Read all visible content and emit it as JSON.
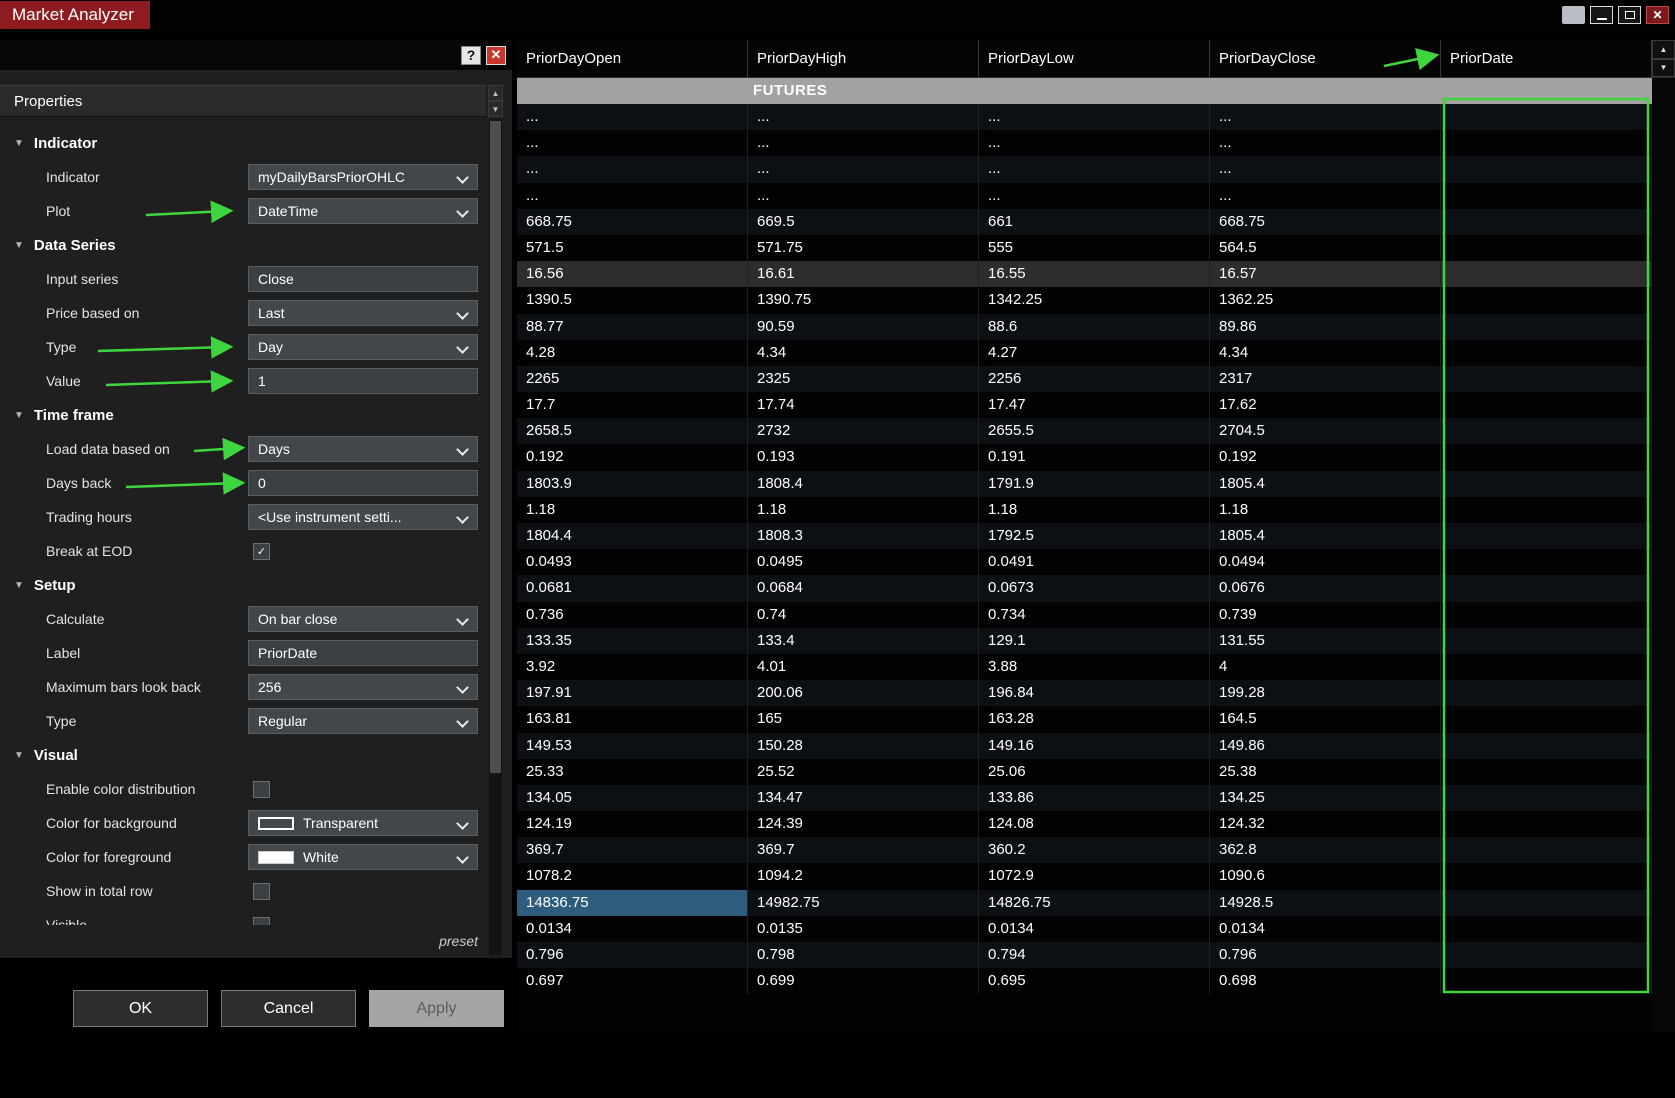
{
  "window": {
    "title": "Market Analyzer"
  },
  "icons": {
    "help": "?",
    "close": "✕",
    "check": "✓",
    "collapse_arrow": "▼",
    "scroll_up": "▲",
    "scroll_down": "▼"
  },
  "dialog": {
    "header": "Properties",
    "sections": [
      {
        "label": "Indicator",
        "rows": [
          {
            "label": "Indicator",
            "type": "dropdown",
            "value": "myDailyBarsPriorOHLC"
          },
          {
            "label": "Plot",
            "type": "dropdown",
            "value": "DateTime"
          }
        ]
      },
      {
        "label": "Data Series",
        "rows": [
          {
            "label": "Input series",
            "type": "text",
            "value": "Close"
          },
          {
            "label": "Price based on",
            "type": "dropdown",
            "value": "Last"
          },
          {
            "label": "Type",
            "type": "dropdown",
            "value": "Day"
          },
          {
            "label": "Value",
            "type": "text",
            "value": "1"
          }
        ]
      },
      {
        "label": "Time frame",
        "rows": [
          {
            "label": "Load data based on",
            "type": "dropdown",
            "value": "Days"
          },
          {
            "label": "Days back",
            "type": "text",
            "value": "0"
          },
          {
            "label": "Trading hours",
            "type": "dropdown",
            "value": "<Use instrument setti..."
          },
          {
            "label": "Break at EOD",
            "type": "checkbox",
            "checked": true
          }
        ]
      },
      {
        "label": "Setup",
        "rows": [
          {
            "label": "Calculate",
            "type": "dropdown",
            "value": "On bar close"
          },
          {
            "label": "Label",
            "type": "text",
            "value": "PriorDate"
          },
          {
            "label": "Maximum bars look back",
            "type": "dropdown",
            "value": "256"
          },
          {
            "label": "Type",
            "type": "dropdown",
            "value": "Regular"
          }
        ]
      },
      {
        "label": "Visual",
        "rows": [
          {
            "label": "Enable color distribution",
            "type": "checkbox",
            "checked": false
          },
          {
            "label": "Color for background",
            "type": "color",
            "value": "Transparent",
            "swatch": "transparent"
          },
          {
            "label": "Color for foreground",
            "type": "color",
            "value": "White",
            "swatch": "white"
          },
          {
            "label": "Show in total row",
            "type": "checkbox",
            "checked": false
          },
          {
            "label": "Visible",
            "type": "checkbox",
            "checked": false,
            "clipped": true
          }
        ]
      }
    ],
    "preset_label": "preset",
    "buttons": [
      {
        "label": "OK"
      },
      {
        "label": "Cancel"
      },
      {
        "label": "Apply",
        "disabled": true
      }
    ]
  },
  "table": {
    "columns": [
      "PriorDayOpen",
      "PriorDayHigh",
      "PriorDayLow",
      "PriorDayClose",
      "PriorDate"
    ],
    "group_label": "FUTURES",
    "highlighted_row_index": 6,
    "selected_cell": {
      "row": 30,
      "col": 0
    },
    "rows": [
      [
        "...",
        "...",
        "...",
        "..."
      ],
      [
        "...",
        "...",
        "...",
        "..."
      ],
      [
        "...",
        "...",
        "...",
        "..."
      ],
      [
        "...",
        "...",
        "...",
        "..."
      ],
      [
        "668.75",
        "669.5",
        "661",
        "668.75"
      ],
      [
        "571.5",
        "571.75",
        "555",
        "564.5"
      ],
      [
        "16.56",
        "16.61",
        "16.55",
        "16.57"
      ],
      [
        "1390.5",
        "1390.75",
        "1342.25",
        "1362.25"
      ],
      [
        "88.77",
        "90.59",
        "88.6",
        "89.86"
      ],
      [
        "4.28",
        "4.34",
        "4.27",
        "4.34"
      ],
      [
        "2265",
        "2325",
        "2256",
        "2317"
      ],
      [
        "17.7",
        "17.74",
        "17.47",
        "17.62"
      ],
      [
        "2658.5",
        "2732",
        "2655.5",
        "2704.5"
      ],
      [
        "0.192",
        "0.193",
        "0.191",
        "0.192"
      ],
      [
        "1803.9",
        "1808.4",
        "1791.9",
        "1805.4"
      ],
      [
        "1.18",
        "1.18",
        "1.18",
        "1.18"
      ],
      [
        "1804.4",
        "1808.3",
        "1792.5",
        "1805.4"
      ],
      [
        "0.0493",
        "0.0495",
        "0.0491",
        "0.0494"
      ],
      [
        "0.0681",
        "0.0684",
        "0.0673",
        "0.0676"
      ],
      [
        "0.736",
        "0.74",
        "0.734",
        "0.739"
      ],
      [
        "133.35",
        "133.4",
        "129.1",
        "131.55"
      ],
      [
        "3.92",
        "4.01",
        "3.88",
        "4"
      ],
      [
        "197.91",
        "200.06",
        "196.84",
        "199.28"
      ],
      [
        "163.81",
        "165",
        "163.28",
        "164.5"
      ],
      [
        "149.53",
        "150.28",
        "149.16",
        "149.86"
      ],
      [
        "25.33",
        "25.52",
        "25.06",
        "25.38"
      ],
      [
        "134.05",
        "134.47",
        "133.86",
        "134.25"
      ],
      [
        "124.19",
        "124.39",
        "124.08",
        "124.32"
      ],
      [
        "369.7",
        "369.7",
        "360.2",
        "362.8"
      ],
      [
        "1078.2",
        "1094.2",
        "1072.9",
        "1090.6"
      ],
      [
        "14836.75",
        "14982.75",
        "14826.75",
        "14928.5"
      ],
      [
        "0.0134",
        "0.0135",
        "0.0134",
        "0.0134"
      ],
      [
        "0.796",
        "0.798",
        "0.794",
        "0.796"
      ],
      [
        "0.697",
        "0.699",
        "0.695",
        "0.698"
      ]
    ]
  },
  "colors": {
    "annotation": "#3ed63e",
    "selected_cell": "#2d5c7c",
    "highlight_row": "#2d2d2d",
    "title_tab": "#8e1b20"
  }
}
